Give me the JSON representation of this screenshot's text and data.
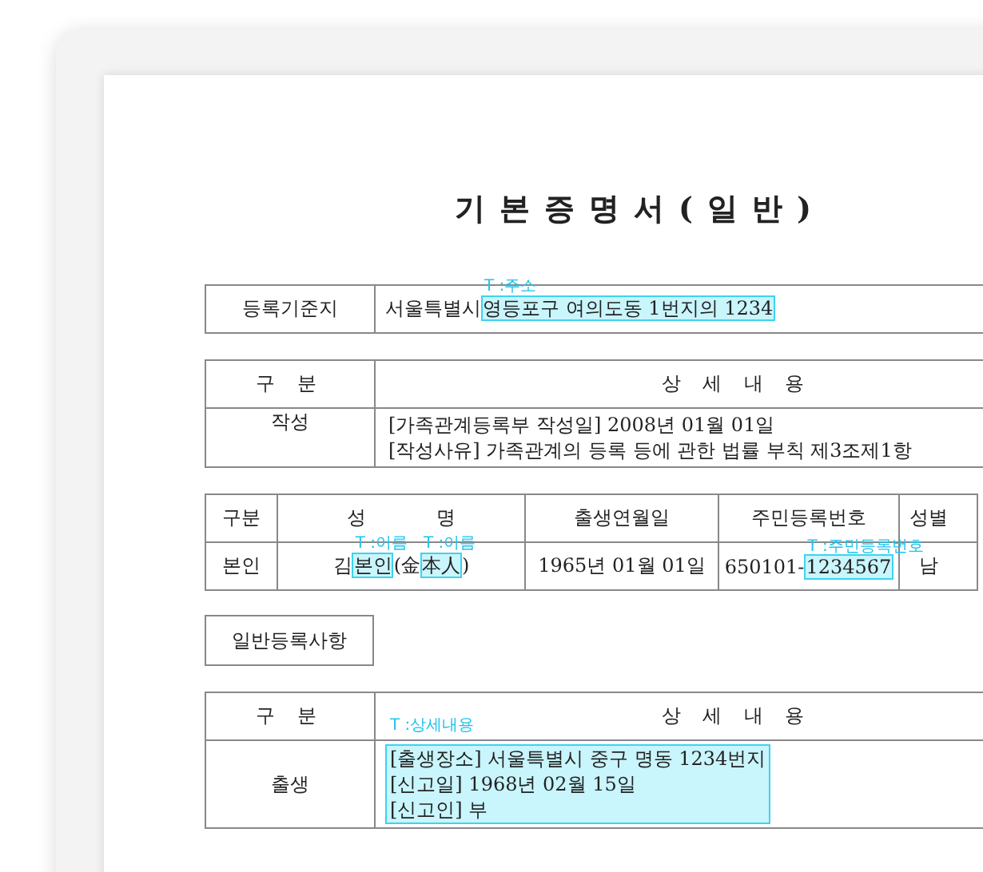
{
  "document": {
    "title": "기본증명서(일반)",
    "registration": {
      "label": "등록기준지",
      "value": [
        {
          "text": "서울특별시",
          "highlighted": false
        },
        {
          "text": "영등포구 여의도동 1번지의 1234",
          "highlighted": true,
          "tag": "T :주소"
        }
      ]
    },
    "record_table": {
      "columns": [
        "구 분",
        "상 세 내 용"
      ],
      "rows": [
        {
          "category": "작성",
          "detail": {
            "highlighted": false,
            "lines": [
              "[가족관계등록부 작성일] 2008년 01월 01일",
              "[작성사유] 가족관계의 등록 등에 관한 법률 부칙 제3조제1항"
            ]
          }
        }
      ]
    },
    "person_table": {
      "columns": [
        "구분",
        "성 명",
        "출생연월일",
        "주민등록번호",
        "성별"
      ],
      "rows": [
        {
          "cells": [
            [
              {
                "text": "본인",
                "highlighted": false
              }
            ],
            [
              {
                "text": "김",
                "highlighted": false
              },
              {
                "text": "본인",
                "highlighted": true,
                "tag": "T :이름"
              },
              {
                "text": "(金",
                "highlighted": false
              },
              {
                "text": "本人",
                "highlighted": true,
                "tag": "T :이름"
              },
              {
                "text": ")",
                "highlighted": false
              }
            ],
            [
              {
                "text": "1965년 01월 01일",
                "highlighted": false
              }
            ],
            [
              {
                "text": "650101-",
                "highlighted": false
              },
              {
                "text": "1234567",
                "highlighted": true,
                "tag": "T :주민등록번호"
              }
            ],
            [
              {
                "text": "남",
                "highlighted": false
              }
            ]
          ]
        }
      ]
    },
    "section_label": "일반등록사항",
    "general_table": {
      "columns": [
        "구 분",
        "상 세 내 용"
      ],
      "rows": [
        {
          "category": "출생",
          "detail": {
            "highlighted": true,
            "tag": "T :상세내용",
            "lines": [
              "[출생장소] 서울특별시 중구 명동 1234번지",
              "[신고일] 1968년 02월 15일",
              "[신고인] 부"
            ]
          }
        }
      ]
    }
  }
}
